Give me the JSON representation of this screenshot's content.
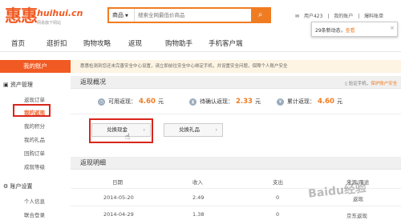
{
  "header": {
    "logo_text": "惠惠",
    "logo_url": "huihui.cn",
    "logo_slogan": "网易旗下网站",
    "search": {
      "category": "商品",
      "placeholder": "搜索全网最低价商品"
    },
    "top_links": [
      "用户423",
      "我的账户",
      "爆料账单"
    ]
  },
  "nav": {
    "items": [
      "首页",
      "逛折扣",
      "购物攻略",
      "返现",
      "购物助手",
      "手机客户端"
    ]
  },
  "popup": {
    "text_a": "29条新动态，",
    "text_b": "查看"
  },
  "sidebar": {
    "header": "我的账户",
    "sections": [
      {
        "title": "资产管理",
        "items": [
          "返现订单",
          "我的返现",
          "我的积分",
          "我的礼品",
          "回购订单",
          "成就等级"
        ]
      },
      {
        "title": "账户设置",
        "items": [
          "个人信息",
          "联合登录"
        ]
      }
    ]
  },
  "notice": "惠惠检测到您还未完善安全中心设置，请立即前往安全中心绑定手机，并设置安全问题，保障个人账户安全",
  "overview": {
    "title": "返现概况",
    "link_prefix": "验证手机，",
    "link_text": "保护账户安全",
    "stats": [
      {
        "label": "可用返现：",
        "value": "4.60",
        "unit": "元"
      },
      {
        "label": "待确认返现：",
        "value": "2.33",
        "unit": "元"
      },
      {
        "label": "累计返现：",
        "value": "4.60",
        "unit": "元"
      }
    ],
    "buttons": [
      "兑换现金",
      "兑换礼品"
    ]
  },
  "details": {
    "title": "返现明细",
    "columns": [
      "日期",
      "收入",
      "支出",
      "来源/用途"
    ],
    "rows": [
      [
        "2014-05-20",
        "2.49",
        "0",
        "返现"
      ],
      [
        "2014-04-29",
        "1.38",
        "0",
        "京东返现"
      ]
    ]
  },
  "watermark": "Baidu经验",
  "colors": {
    "accent": "#f15a22",
    "highlight_box": "#d9261c"
  }
}
